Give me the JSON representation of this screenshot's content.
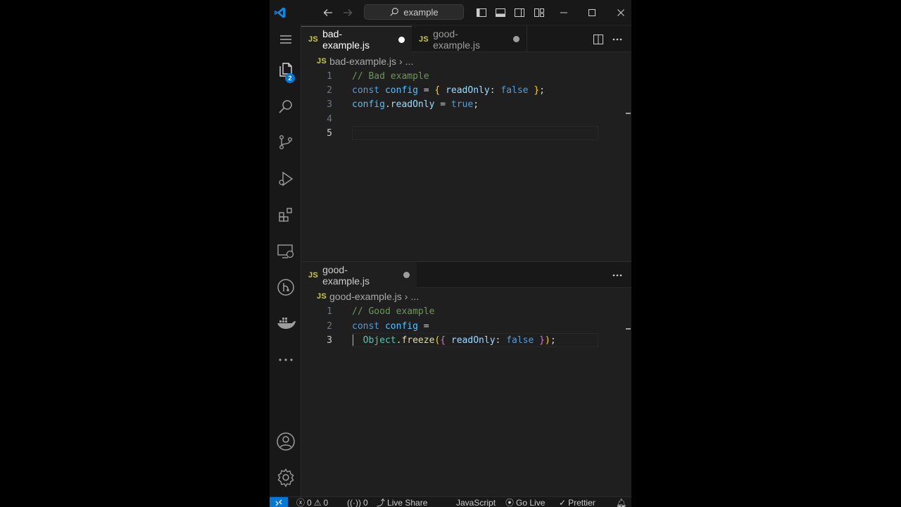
{
  "titlebar": {
    "search_text": "example",
    "icons": [
      "vscode-logo",
      "back-arrow",
      "forward-arrow",
      "search-icon",
      "toggle-primary-sidebar",
      "toggle-panel",
      "toggle-secondary-sidebar",
      "customize-layout",
      "minimize",
      "maximize",
      "close"
    ]
  },
  "activity_bar": {
    "explorer_badge": "2",
    "items": [
      "menu-icon",
      "explorer-icon",
      "search-icon",
      "source-control-icon",
      "run-debug-icon",
      "extensions-icon",
      "remote-explorer-icon",
      "git-graph-icon",
      "docker-icon",
      "more-icon",
      "accounts-icon",
      "settings-gear-icon"
    ]
  },
  "top_group": {
    "tabs": [
      {
        "badge": "JS",
        "label": "bad-example.js"
      },
      {
        "badge": "JS",
        "label": "good-example.js"
      }
    ],
    "breadcrumb": {
      "badge": "JS",
      "file": "bad-example.js",
      "more": "..."
    },
    "lines": [
      {
        "n": "1",
        "tokens": [
          {
            "t": "// Bad example",
            "c": "cmt"
          }
        ]
      },
      {
        "n": "2",
        "tokens": [
          {
            "t": "const ",
            "c": "kw"
          },
          {
            "t": "config",
            "c": "var"
          },
          {
            "t": " = ",
            "c": "op"
          },
          {
            "t": "{",
            "c": "br1"
          },
          {
            "t": " readOnly",
            "c": "prop"
          },
          {
            "t": ": ",
            "c": "op"
          },
          {
            "t": "false",
            "c": "kw"
          },
          {
            "t": " ",
            "c": "op"
          },
          {
            "t": "}",
            "c": "br1"
          },
          {
            "t": ";",
            "c": "op"
          }
        ]
      },
      {
        "n": "3",
        "tokens": [
          {
            "t": "config",
            "c": "var"
          },
          {
            "t": ".",
            "c": "op"
          },
          {
            "t": "readOnly",
            "c": "prop"
          },
          {
            "t": " = ",
            "c": "op"
          },
          {
            "t": "true",
            "c": "kw"
          },
          {
            "t": ";",
            "c": "op"
          }
        ]
      },
      {
        "n": "4",
        "tokens": []
      },
      {
        "n": "5",
        "tokens": []
      }
    ]
  },
  "bottom_group": {
    "tabs": [
      {
        "badge": "JS",
        "label": "good-example.js"
      }
    ],
    "breadcrumb": {
      "badge": "JS",
      "file": "good-example.js",
      "more": "..."
    },
    "lines": [
      {
        "n": "1",
        "tokens": [
          {
            "t": "// Good example",
            "c": "cmt"
          }
        ]
      },
      {
        "n": "2",
        "tokens": [
          {
            "t": "const ",
            "c": "kw"
          },
          {
            "t": "config",
            "c": "var"
          },
          {
            "t": " =",
            "c": "op"
          }
        ]
      },
      {
        "n": "3",
        "tokens": [
          {
            "t": "  ",
            "c": "op"
          },
          {
            "t": "Object",
            "c": "cls"
          },
          {
            "t": ".",
            "c": "op"
          },
          {
            "t": "freeze",
            "c": "fn"
          },
          {
            "t": "(",
            "c": "br1"
          },
          {
            "t": "{",
            "c": "br2"
          },
          {
            "t": " readOnly",
            "c": "prop"
          },
          {
            "t": ": ",
            "c": "op"
          },
          {
            "t": "false",
            "c": "kw"
          },
          {
            "t": " ",
            "c": "op"
          },
          {
            "t": "}",
            "c": "br2"
          },
          {
            "t": ")",
            "c": "br1"
          },
          {
            "t": ";",
            "c": "op"
          }
        ]
      }
    ]
  },
  "status_bar": {
    "errors": "0",
    "warnings": "0",
    "ports": "0",
    "live_share": "Live Share",
    "language": "JavaScript",
    "go_live": "Go Live",
    "prettier": "Prettier"
  },
  "colors": {
    "accent": "#0078d4",
    "modified_dot": "#ffffff",
    "modified_dot_inactive": "#9d9d9d"
  }
}
